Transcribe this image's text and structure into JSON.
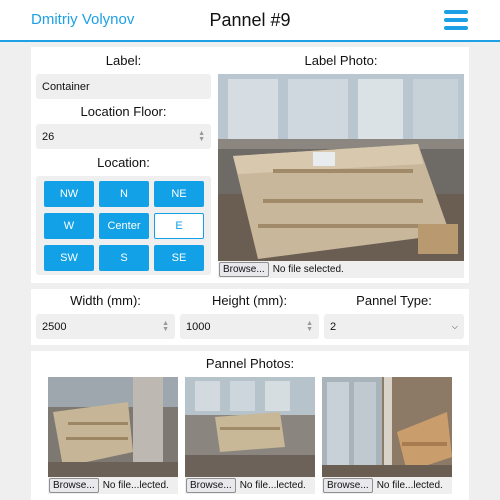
{
  "header": {
    "user_name": "Dmitriy Volynov",
    "title": "Pannel #9"
  },
  "label_section": {
    "label_heading": "Label:",
    "label_value": "Container",
    "floor_heading": "Location Floor:",
    "floor_value": "26",
    "location_heading": "Location:",
    "location_options": [
      "NW",
      "N",
      "NE",
      "W",
      "Center",
      "E",
      "SW",
      "S",
      "SE"
    ],
    "location_selected": "E"
  },
  "label_photo": {
    "heading": "Label Photo:",
    "browse_label": "Browse...",
    "file_status": "No file selected."
  },
  "dimensions": {
    "width_heading": "Width (mm):",
    "width_value": "2500",
    "height_heading": "Height (mm):",
    "height_value": "1000",
    "type_heading": "Pannel Type:",
    "type_value": "2"
  },
  "pannel_photos": {
    "heading": "Pannel Photos:",
    "items": [
      {
        "browse_label": "Browse...",
        "file_status": "No file...lected."
      },
      {
        "browse_label": "Browse...",
        "file_status": "No file...lected."
      },
      {
        "browse_label": "Browse...",
        "file_status": "No file...lected."
      }
    ]
  },
  "colors": {
    "accent": "#1ea0e6",
    "button": "#12a0e6",
    "field_bg": "#efefef"
  }
}
